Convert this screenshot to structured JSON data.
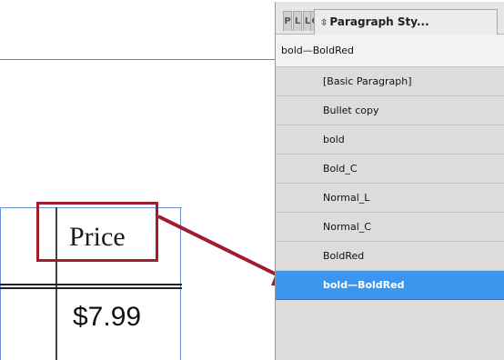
{
  "panel": {
    "tabs": [
      "P",
      "L",
      "L",
      "C"
    ],
    "active_tab_icon": "up-down-arrows-icon",
    "active_tab_label": "Paragraph Sty...",
    "current_style": "bold—BoldRed",
    "styles": [
      "[Basic Paragraph]",
      "Bullet copy",
      "bold",
      "Bold_C",
      "Normal_L",
      "Normal_C",
      "BoldRed",
      "bold—BoldRed"
    ],
    "selected_style": "bold—BoldRed"
  },
  "canvas": {
    "header_cell": "Price",
    "value_cell": "$7.99"
  },
  "colors": {
    "selection": "#3c96ee",
    "annotation": "#a11d2e",
    "guide": "#e040e0",
    "frame": "#6a8fd8"
  }
}
